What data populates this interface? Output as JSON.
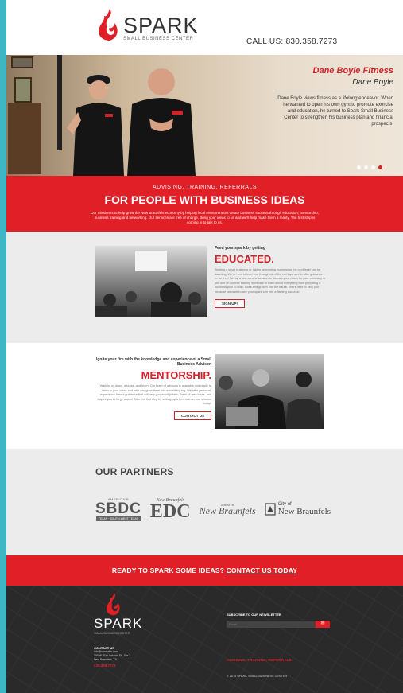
{
  "header": {
    "brand": "SPARK",
    "brand_sub": "SMALL BUSINESS CENTER",
    "phone": "CALL US: 830.358.7273"
  },
  "hero": {
    "title": "Dane Boyle Fitness",
    "name": "Dane Boyle",
    "description": "Dane Boyle views fitness as a lifelong endeavor. When he wanted to open his own gym to promote exercise and education, he turned to Spark Small Business Center to strengthen his business plan and financial prospects.",
    "slides": 4,
    "active_slide": 4
  },
  "mission": {
    "kicker": "ADVISING, TRAINING, REFERRALS",
    "title": "FOR PEOPLE WITH BUSINESS IDEAS",
    "text": "Our mission is to help grow the New Braunfels economy by helping local entrepreneurs create business success through education, mentorship, business training and networking. Our services are free of charge. Bring your ideas to us and we'll help make them a reality. The first step is coming in to talk to us."
  },
  "educated": {
    "kicker": "Feed your spark by getting",
    "title": "EDUCATED.",
    "text": "Starting a small business or taking an existing business to the next level can be daunting. We're here to lead you through all of the red tape and to offer guidance — for free! Set up a one-on-one session to discuss your vision for your company or join one of our free training seminars to learn about everything from preparing a business plan to lean, loose and growth into the future. We're here to help you because we want to see your spark turn into a flaming success!",
    "button": "SIGN UP!"
  },
  "mentorship": {
    "kicker": "Ignite your fire with the knowledge and experience of a Small Business Advisor.",
    "title": "MENTORSHIP.",
    "text": "Walk in, sit down, discuss, and learn. Our team of advisors is available and ready to listen to your ideas and help you grow them into something big. We offer personal, experience-based guidance that will help you avoid pitfalls. Think of new ideas, and inspire you to forge ahead. Take the first step by setting up a free one-on-one session today!",
    "button": "CONTACT US"
  },
  "partners": {
    "title": "OUR PARTNERS",
    "sbdc": {
      "top": "AMERICA'S",
      "main": "SBDC",
      "bar": "TEXAS · SOUTH-WEST TEXAS"
    },
    "edc": {
      "top": "New Braunfels",
      "main": "EDC"
    },
    "chamber": {
      "small": "GREATER",
      "main": "New Braunfels"
    },
    "city": {
      "top": "City of",
      "main": "New Braunfels"
    }
  },
  "cta": {
    "text": "READY TO SPARK SOME IDEAS?",
    "link": "CONTACT US TODAY"
  },
  "footer": {
    "brand": "SPARK",
    "brand_sub": "SMALL BUSINESS CENTER",
    "contact_heading": "CONTACT US",
    "email": "info@sparksbc.com",
    "address1": "390 W. San Antonio St., Ste 3",
    "address2": "New Braunfels, TX",
    "phone": "830.358.7273",
    "newsletter_heading": "SUBSCRIBE TO OUR NEWSLETTER",
    "newsletter_placeholder": "Email",
    "tagline": "ADVISING, TRAINING, REFERRALS",
    "copyright": "© 2015 SPARK SMALL BUSINESS CENTER"
  },
  "colors": {
    "brand_red": "#e11f26",
    "accent_teal": "#3fb6c4",
    "footer_dark": "#2a2a2a"
  }
}
